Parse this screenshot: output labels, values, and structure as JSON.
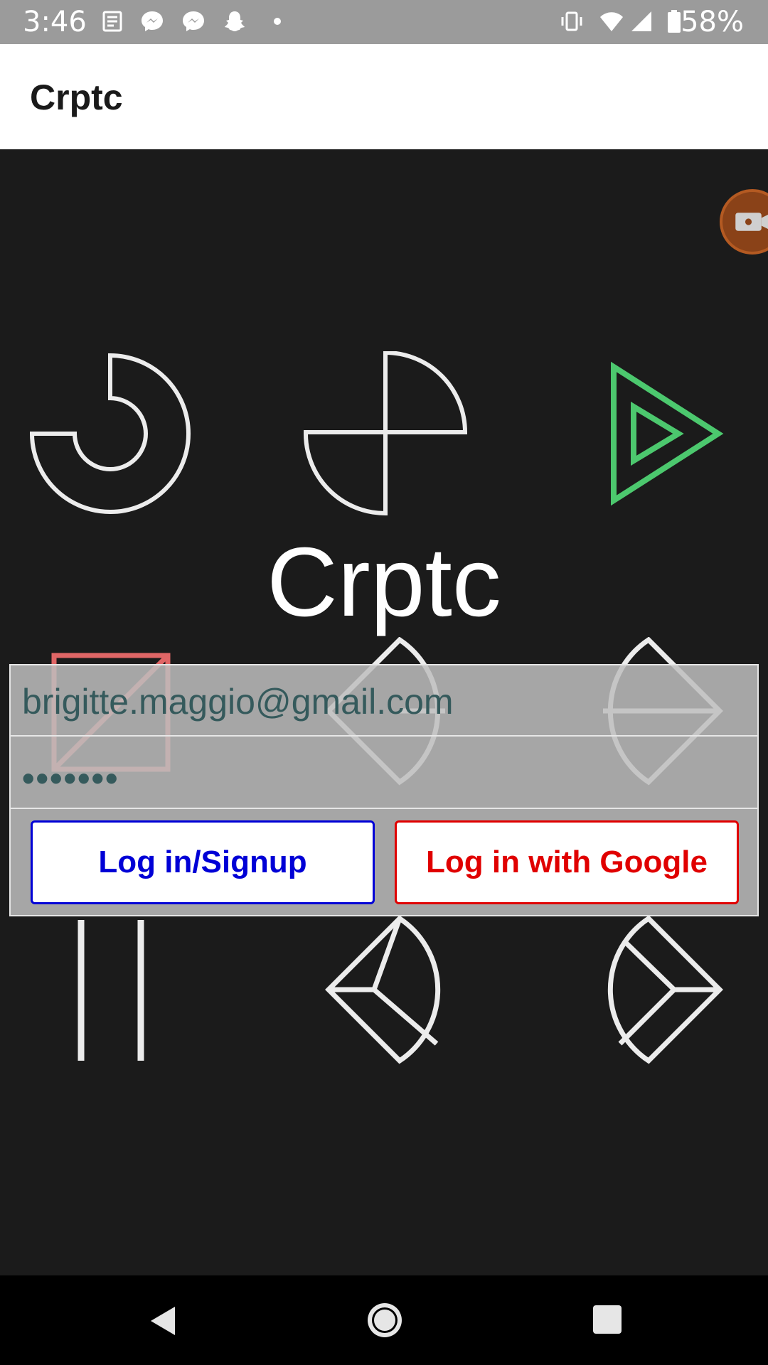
{
  "status_bar": {
    "time": "3:46",
    "battery": "58%",
    "notification_icons": [
      "news-icon",
      "messenger-icon",
      "messenger-icon",
      "snapchat-icon",
      "dot-icon"
    ],
    "system_icons": [
      "vibrate-icon",
      "wifi-icon",
      "signal-icon",
      "battery-icon"
    ]
  },
  "app_bar": {
    "title": "Crptc"
  },
  "hero": {
    "title": "Crptc"
  },
  "login": {
    "email_value": "brigitte.maggio@gmail.com",
    "password_value": "•••••••",
    "login_button": "Log in/Signup",
    "google_button": "Log in with Google"
  },
  "colors": {
    "login_button": "#0000d6",
    "google_button": "#e00000",
    "glyph_green": "#4cc86e",
    "glyph_red": "#e06666",
    "glyph_white": "#ececec"
  },
  "nav_bar": {
    "icons": [
      "back-icon",
      "home-icon",
      "recents-icon"
    ]
  }
}
